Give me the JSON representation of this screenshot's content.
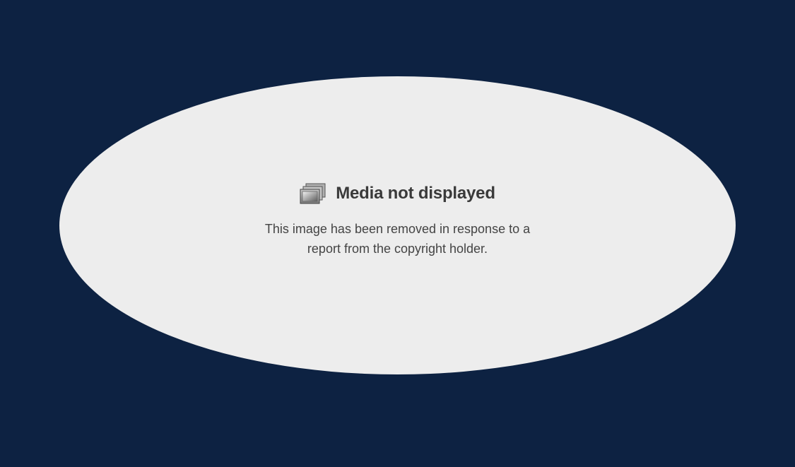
{
  "colors": {
    "background": "#0d2242",
    "ellipse_fill": "#ededed",
    "title_text": "#3a3a3a",
    "message_text": "#444444"
  },
  "notice": {
    "icon": "media-stack-icon",
    "title": "Media not displayed",
    "message_line_1": "This image has been removed in response to a",
    "message_line_2": "report from the copyright holder."
  }
}
